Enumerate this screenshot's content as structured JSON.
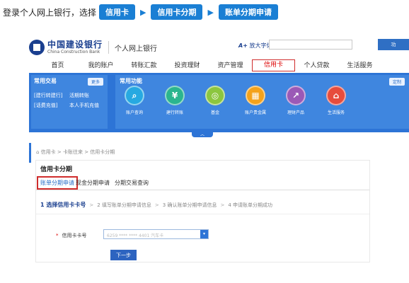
{
  "instruction": {
    "lead": "登录个人网上银行，选择",
    "path": [
      "信用卡",
      "信用卡分期",
      "账单分期申请"
    ]
  },
  "header": {
    "bank_name_cn": "中国建设银行",
    "bank_name_en": "China Construction Bank",
    "site_name": "个人网上银行",
    "font_size_label": "放大字体",
    "font_size_prefix": "A+",
    "search_button_label": "功"
  },
  "nav": [
    "首页",
    "我的账户",
    "转账汇款",
    "投资理财",
    "资产管理",
    "信用卡",
    "个人贷款",
    "生活服务"
  ],
  "quick_panel": {
    "title": "常用交易",
    "more_label": "更多",
    "items": [
      "[建行转建行]",
      "活期转账",
      "[话费充值]",
      "本人手机充值"
    ]
  },
  "function_panel": {
    "title": "常用功能",
    "customize_label": "定制",
    "items": [
      {
        "label": "账户查询",
        "icon": "search-icon",
        "color": "#27a9e1"
      },
      {
        "label": "建行转账",
        "icon": "yen-icon",
        "color": "#2bb58e"
      },
      {
        "label": "基金",
        "icon": "coins-icon",
        "color": "#8cc63f"
      },
      {
        "label": "账户贵金属",
        "icon": "bars-icon",
        "color": "#f4a21b"
      },
      {
        "label": "理财产品",
        "icon": "chart-icon",
        "color": "#9b59b6"
      },
      {
        "label": "生活服务",
        "icon": "house-icon",
        "color": "#e74c3c"
      }
    ]
  },
  "side_tab": "展开",
  "breadcrumb": "信用卡 > 卡账往来 > 信用卡分期",
  "content": {
    "title": "信用卡分期",
    "tabs": [
      "账单分期申请",
      "现金分期申请",
      "分期交易查询"
    ],
    "steps": [
      "1 选择信用卡卡号",
      "2 填写账单分期申请信息",
      "3 确认账单分期申请信息",
      "4 申请账单分期成功"
    ],
    "card_label": "信用卡卡号",
    "card_select_value": "6259 **** **** 4401 汽车卡",
    "next_button": "下一步"
  },
  "colors": {
    "accent": "#1a7fd4",
    "band": "#2d74d6",
    "highlight": "#cf2c2c"
  }
}
